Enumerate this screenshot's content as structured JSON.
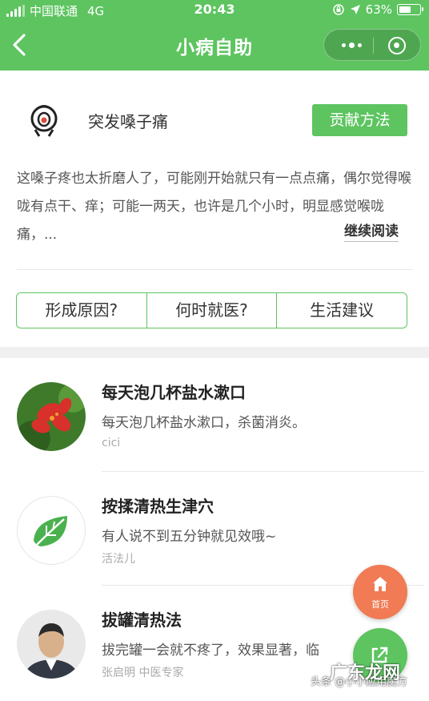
{
  "status_bar": {
    "carrier": "中国联通",
    "network": "4G",
    "time": "20:43",
    "battery": "63%",
    "battery_level": 0.63
  },
  "nav": {
    "title": "小病自助",
    "back_icon": "chevron-left-icon",
    "more_icon": "more-dots-icon",
    "close_icon": "target-circle-icon"
  },
  "topic": {
    "title": "突发嗓子痛",
    "contribute_label": "贡献方法",
    "intro": "这嗓子疼也太折磨人了，可能刚开始就只有一点点痛，偶尔觉得喉咙有点干、痒；可能一两天，也许是几个小时，明显感觉喉咙痛，...",
    "read_more": "继续阅读"
  },
  "tabs": [
    {
      "label": "形成原因?"
    },
    {
      "label": "何时就医?"
    },
    {
      "label": "生活建议"
    }
  ],
  "methods": [
    {
      "title": "每天泡几杯盐水漱口",
      "desc": "每天泡几杯盐水漱口，杀菌消炎。",
      "author": "cici"
    },
    {
      "title": "按揉清热生津穴",
      "desc": "有人说不到五分钟就见效哦~",
      "author": "活法儿"
    },
    {
      "title": "拔罐清热法",
      "desc": "拔完罐一会就不疼了，效果显著，临",
      "author": "张启明 中医专家"
    }
  ],
  "fab": {
    "home_label": "首页",
    "home_icon": "house-icon",
    "share_icon": "share-icon"
  },
  "watermark": {
    "prefix": "头条 @小小应用魔方",
    "brand": "广东龙网"
  },
  "colors": {
    "primary": "#5dc460",
    "accent": "#f07b55"
  }
}
